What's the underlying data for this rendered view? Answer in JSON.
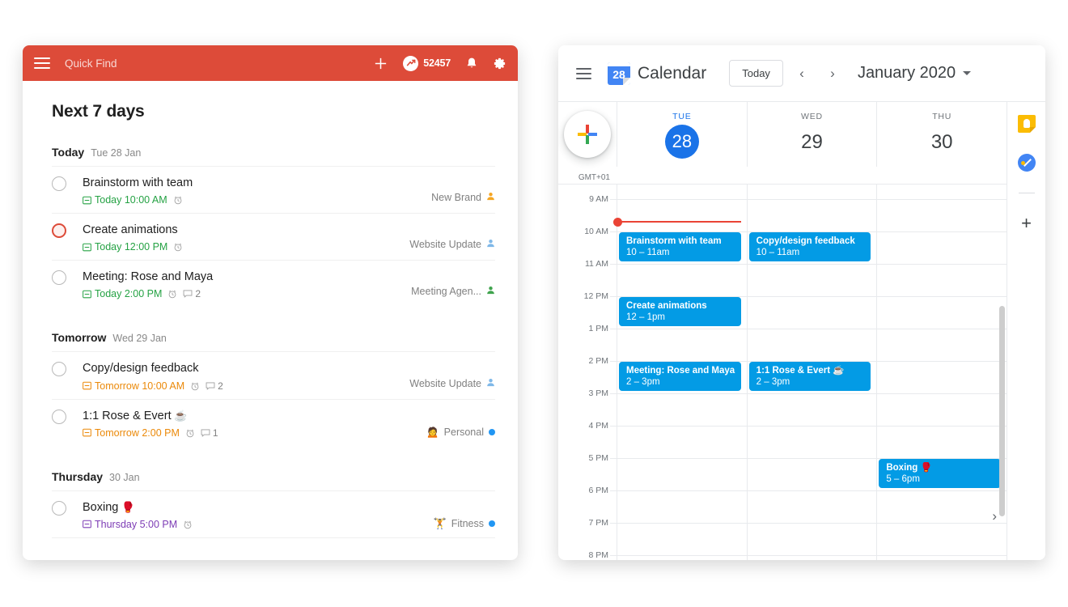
{
  "todoist": {
    "header": {
      "menu_icon": "hamburger-menu-icon",
      "search_placeholder": "Quick Find",
      "add_icon": "plus-icon",
      "karma_icon": "karma-trend-icon",
      "karma_points": "52457",
      "notifications_icon": "bell-icon",
      "settings_icon": "gear-icon",
      "accent_color": "#dd4b39"
    },
    "page_title": "Next 7 days",
    "groups": [
      {
        "name": "Today",
        "date": "Tue 28 Jan",
        "tasks": [
          {
            "title": "Brainstorm with team",
            "date_text": "Today 10:00 AM",
            "date_color": "green",
            "has_alarm": true,
            "comments": "",
            "project": "New Brand",
            "project_marker": "avatar-orange",
            "priority": "normal"
          },
          {
            "title": "Create animations",
            "date_text": "Today 12:00 PM",
            "date_color": "green",
            "has_alarm": true,
            "comments": "",
            "project": "Website Update",
            "project_marker": "avatar-blue",
            "priority": "p2"
          },
          {
            "title": "Meeting: Rose and Maya",
            "date_text": "Today 2:00 PM",
            "date_color": "green",
            "has_alarm": true,
            "comments": "2",
            "project": "Meeting Agen...",
            "project_marker": "avatar-green",
            "priority": "normal"
          }
        ]
      },
      {
        "name": "Tomorrow",
        "date": "Wed 29 Jan",
        "tasks": [
          {
            "title": "Copy/design feedback",
            "date_text": "Tomorrow 10:00 AM",
            "date_color": "orange",
            "has_alarm": true,
            "comments": "2",
            "project": "Website Update",
            "project_marker": "avatar-blue",
            "priority": "normal"
          },
          {
            "title": "1:1 Rose & Evert",
            "title_emoji": "☕",
            "date_text": "Tomorrow 2:00 PM",
            "date_color": "orange",
            "has_alarm": true,
            "comments": "1",
            "project": "Personal",
            "project_emoji": "🙍",
            "project_marker": "dot-blue",
            "priority": "normal"
          }
        ]
      },
      {
        "name": "Thursday",
        "date": "30 Jan",
        "tasks": [
          {
            "title": "Boxing",
            "title_emoji": "🥊",
            "date_text": "Thursday 5:00 PM",
            "date_color": "purple",
            "has_alarm": true,
            "comments": "",
            "project": "Fitness",
            "project_emoji": "🏋",
            "project_marker": "dot-blue",
            "priority": "normal"
          }
        ]
      }
    ]
  },
  "gcal": {
    "header": {
      "menu_icon": "hamburger-menu-icon",
      "logo_day": "28",
      "title": "Calendar",
      "today_label": "Today",
      "prev_icon": "chevron-left-icon",
      "next_icon": "chevron-right-icon",
      "range_label": "January 2020",
      "view_caret_icon": "chevron-down-icon"
    },
    "create_button_icon": "google-plus-create-icon",
    "timezone": "GMT+01",
    "days": [
      {
        "dow": "TUE",
        "num": "28",
        "today": true
      },
      {
        "dow": "WED",
        "num": "29",
        "today": false
      },
      {
        "dow": "THU",
        "num": "30",
        "today": false
      }
    ],
    "hours": [
      "9 AM",
      "10 AM",
      "11 AM",
      "12 PM",
      "1 PM",
      "2 PM",
      "3 PM",
      "4 PM",
      "5 PM",
      "6 PM",
      "7 PM",
      "8 PM"
    ],
    "event_color": "#039be5",
    "now_indicator_color": "#ea4335",
    "events": [
      {
        "day": 0,
        "title": "Brainstorm with team",
        "time": "10 – 11am",
        "start": 10,
        "end": 11
      },
      {
        "day": 0,
        "title": "Create animations",
        "time": "12 – 1pm",
        "start": 12,
        "end": 13
      },
      {
        "day": 0,
        "title": "Meeting: Rose and Maya",
        "time": "2 – 3pm",
        "start": 14,
        "end": 15
      },
      {
        "day": 1,
        "title": "Copy/design feedback",
        "time": "10 – 11am",
        "start": 10,
        "end": 11
      },
      {
        "day": 1,
        "title": "1:1 Rose & Evert",
        "emoji": "☕",
        "time": "2 – 3pm",
        "start": 14,
        "end": 15
      },
      {
        "day": 2,
        "title": "Boxing",
        "emoji": "🥊",
        "time": "5 – 6pm",
        "start": 17,
        "end": 18
      }
    ],
    "sidebar": [
      {
        "icon": "google-keep-icon"
      },
      {
        "icon": "google-tasks-icon"
      },
      {
        "icon": "add-addon-icon"
      }
    ],
    "expand_icon": "chevron-right-icon"
  }
}
